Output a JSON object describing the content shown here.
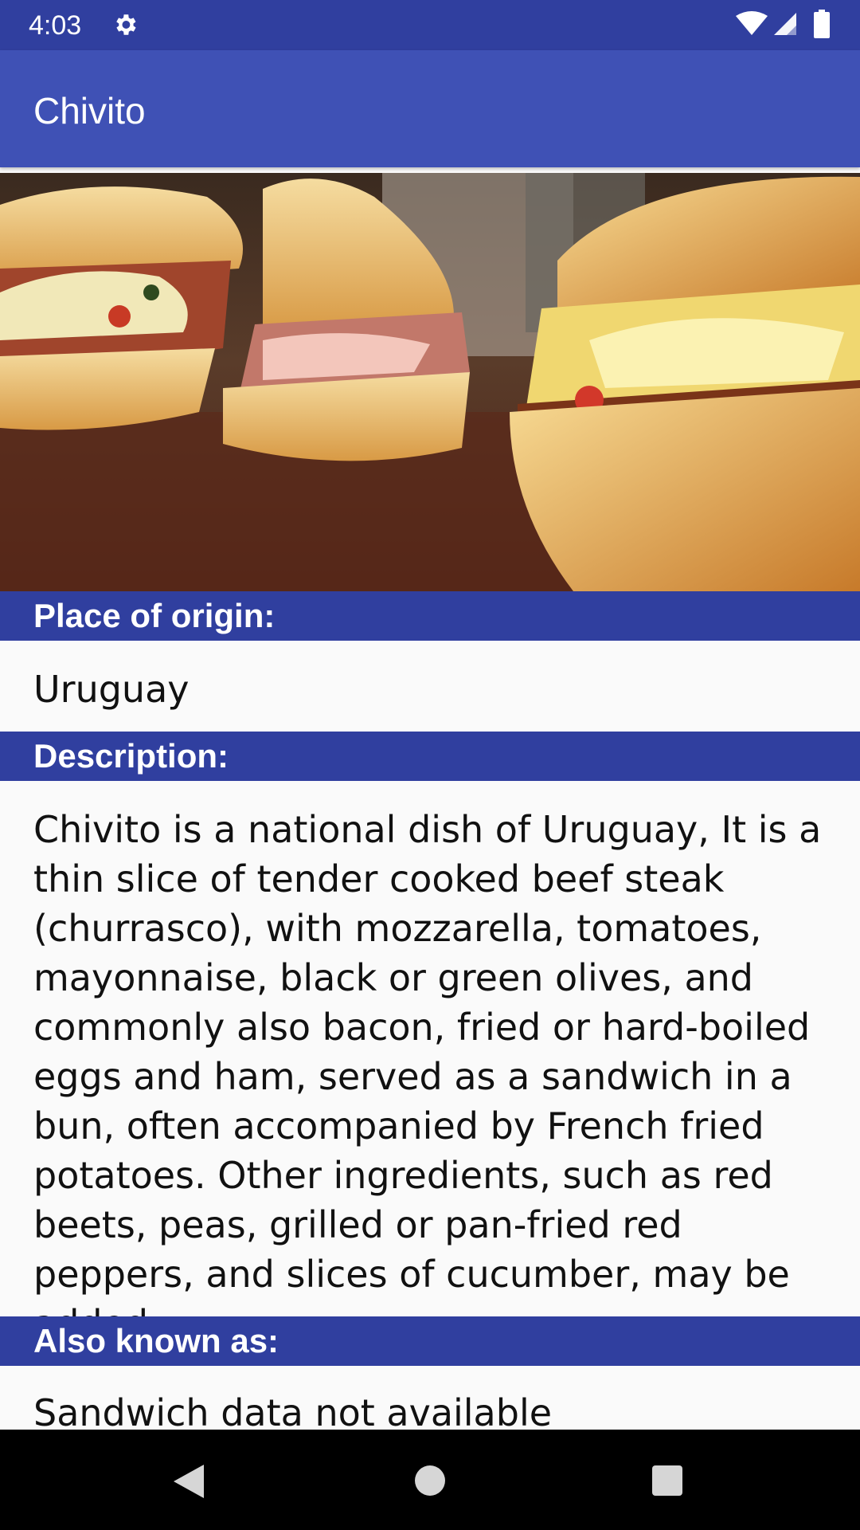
{
  "status_bar": {
    "time": "4:03",
    "icons": [
      "settings-gear-icon",
      "wifi-icon",
      "cell-signal-icon",
      "battery-icon"
    ]
  },
  "app_bar": {
    "title": "Chivito"
  },
  "hero_image": {
    "subject": "chivito-sandwich-photo"
  },
  "sections": {
    "origin": {
      "header": "Place of origin:",
      "value": "Uruguay"
    },
    "description": {
      "header": "Description:",
      "value": "Chivito is a national dish of Uruguay, It is a thin slice of tender cooked beef steak (churrasco), with mozzarella, tomatoes, mayonnaise, black or green olives, and commonly also bacon, fried or hard-boiled eggs and ham, served as a sandwich in a bun, often accompanied by French fried potatoes. Other ingredients, such as red beets, peas, grilled or pan-fried red peppers, and slices of cucumber, may be added."
    },
    "aka": {
      "header": "Also known as:",
      "value": "Sandwich data not available"
    }
  },
  "nav_bar": {
    "icons": [
      "back-icon",
      "home-icon",
      "recents-icon"
    ]
  },
  "colors": {
    "primary": "#3f51b5",
    "primary_dark": "#303f9f",
    "background": "#fafafa"
  }
}
